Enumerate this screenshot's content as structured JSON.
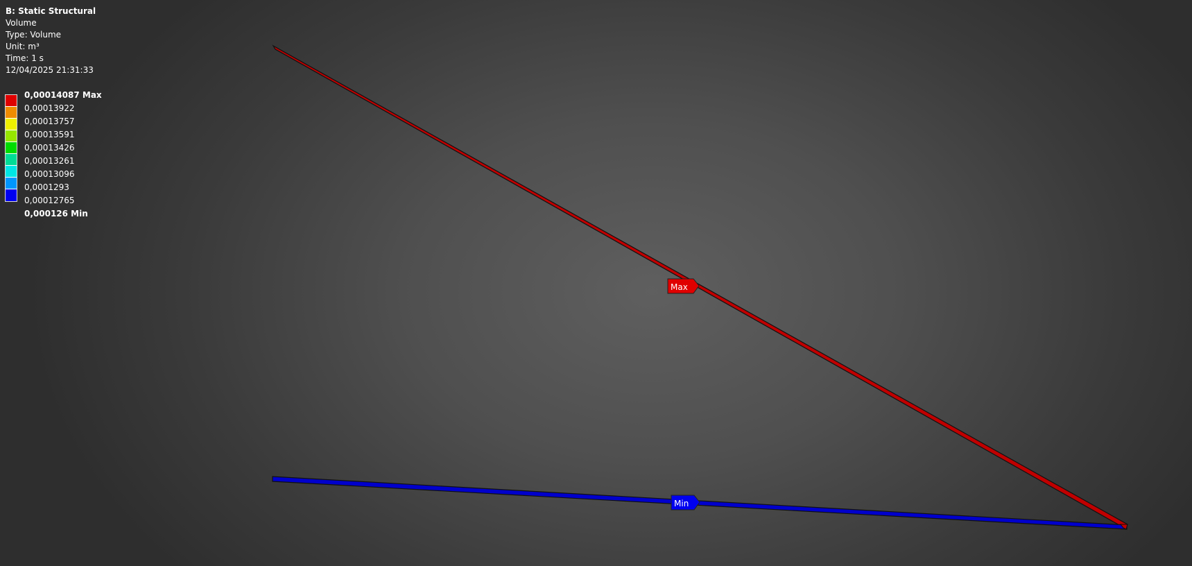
{
  "header": {
    "analysis": "B: Static Structural",
    "result_name": "Volume",
    "type_line": "Type: Volume",
    "unit_line": "Unit: m³",
    "time_line": "Time: 1 s",
    "timestamp": "12/04/2025 21:31:33"
  },
  "legend": {
    "colors": [
      "#e00000",
      "#f08c00",
      "#f0f000",
      "#96e600",
      "#00dc00",
      "#00dc96",
      "#00e6e6",
      "#0096ff",
      "#0000f0"
    ],
    "labels": [
      "0,00014087 Max",
      "0,00013922",
      "0,00013757",
      "0,00013591",
      "0,00013426",
      "0,00013261",
      "0,00013096",
      "0,0001293",
      "0,00012765",
      "0,000126 Min"
    ]
  },
  "markers": {
    "max_label": "Max",
    "min_label": "Min"
  },
  "members": {
    "upper_color": "#c00000",
    "lower_color": "#0000cc"
  }
}
